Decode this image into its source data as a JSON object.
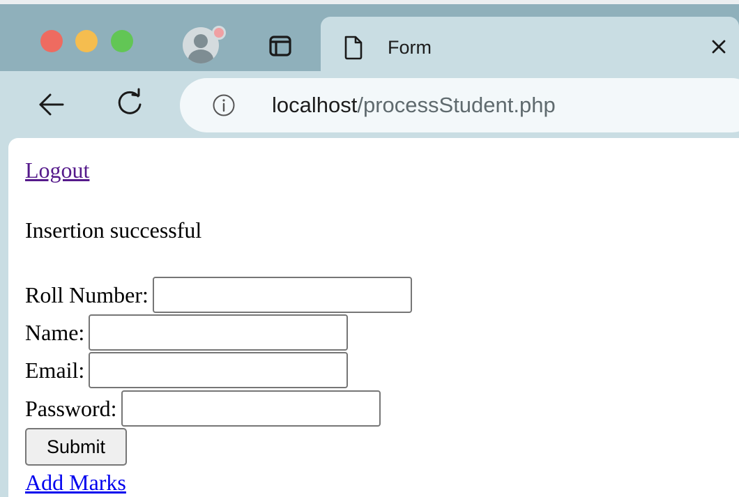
{
  "browser": {
    "tab": {
      "title": "Form"
    },
    "address_bar": {
      "host": "localhost",
      "path": "/processStudent.php"
    },
    "icons": {
      "back": "arrow-left-icon",
      "reload": "reload-icon",
      "site_info": "info-icon",
      "tab_close": "close-icon",
      "tab_favicon": "document-icon",
      "tab_strip": "sidebar-panel-icon",
      "profile": "user-avatar-icon"
    },
    "colors": {
      "frame": "#8fb0bb",
      "toolbar": "#c9dde3",
      "close_light": "#ee6b60",
      "minimize_light": "#f5bd4f",
      "zoom_light": "#62c655"
    }
  },
  "page": {
    "logout_label": "Logout",
    "status_message": "Insertion successful",
    "form": {
      "roll_number": {
        "label": "Roll Number:",
        "value": ""
      },
      "name": {
        "label": "Name:",
        "value": ""
      },
      "email": {
        "label": "Email:",
        "value": ""
      },
      "password": {
        "label": "Password:",
        "value": ""
      },
      "submit_label": "Submit"
    },
    "add_marks_label": "Add Marks",
    "colors": {
      "visited_link": "#551a8b",
      "link": "#0000ee"
    }
  }
}
